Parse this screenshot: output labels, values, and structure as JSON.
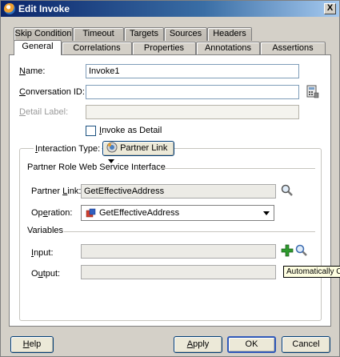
{
  "window": {
    "title": "Edit Invoke",
    "close_glyph": "X"
  },
  "tabs_row1": [
    {
      "label": "Skip Condition"
    },
    {
      "label": "Timeout"
    },
    {
      "label": "Targets"
    },
    {
      "label": "Sources"
    },
    {
      "label": "Headers"
    }
  ],
  "tabs_row2": [
    {
      "label": "General",
      "active": true
    },
    {
      "label": "Correlations"
    },
    {
      "label": "Properties"
    },
    {
      "label": "Annotations"
    },
    {
      "label": "Assertions"
    }
  ],
  "general": {
    "name_label_u": "N",
    "name_label_rest": "ame:",
    "name_value": "Invoke1",
    "conversation_label_u": "C",
    "conversation_label_rest": "onversation ID:",
    "conversation_value": "",
    "detail_label_u": "D",
    "detail_label_rest": "etail Label:",
    "detail_value": "",
    "invoke_as_detail_u": "I",
    "invoke_as_detail_rest": "nvoke as Detail",
    "invoke_as_detail_checked": false
  },
  "interaction": {
    "label_u": "I",
    "label_rest": "nteraction Type:",
    "type_value": "Partner Link",
    "section_title": "Partner Role Web Service Interface",
    "partner_link_label_u": "L",
    "partner_link_label_pre": "Partner ",
    "partner_link_label_rest": "ink:",
    "partner_link_value": "GetEffectiveAddress",
    "operation_label_u": "e",
    "operation_label_pre": "Op",
    "operation_label_rest": "ration:",
    "operation_value": "GetEffectiveAddress"
  },
  "variables": {
    "title": "Variables",
    "input_label_u": "I",
    "input_label_rest": "nput:",
    "input_value": "",
    "output_label_pre": "O",
    "output_label_u": "u",
    "output_label_rest": "tput:",
    "output_value": "",
    "tooltip": "Automatically C"
  },
  "buttons": {
    "help_u": "H",
    "help_rest": "elp",
    "apply_u": "A",
    "apply_rest": "pply",
    "ok": "OK",
    "cancel": "Cancel"
  },
  "colors": {
    "title_start": "#0a246a",
    "title_end": "#a6caf0",
    "add_icon": "#2e9a2e"
  }
}
